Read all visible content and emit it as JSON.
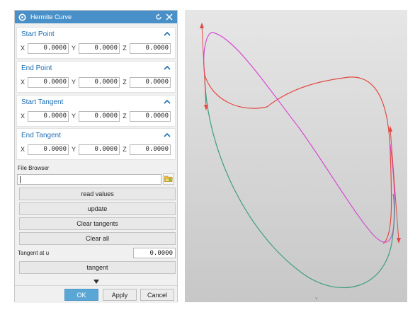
{
  "dialog": {
    "title": "Hermite Curve",
    "title_bar_color": "#4a90c8",
    "accent_text_color": "#1f6fb3",
    "sections": [
      {
        "title": "Start Point",
        "x": "0.0000",
        "y": "0.0000",
        "z": "0.0000"
      },
      {
        "title": "End Point",
        "x": "0.0000",
        "y": "0.0000",
        "z": "0.0000"
      },
      {
        "title": "Start Tangent",
        "x": "0.0000",
        "y": "0.0000",
        "z": "0.0000"
      },
      {
        "title": "End Tangent",
        "x": "0.0000",
        "y": "0.0000",
        "z": "0.0000"
      }
    ],
    "axis_labels": {
      "x": "X",
      "y": "Y",
      "z": "Z"
    },
    "file_browser": {
      "label": "File Browser",
      "value": ""
    },
    "buttons": {
      "read_values": "read values",
      "update": "update",
      "clear_tangents": "Clear tangents",
      "clear_all": "Clear all",
      "tangent": "tangent"
    },
    "tangent_at_u": {
      "label": "Tangent at u",
      "value": "0.0000"
    },
    "footer": {
      "ok": "OK",
      "apply": "Apply",
      "cancel": "Cancel",
      "ok_color": "#5aa7d6"
    }
  },
  "viewport": {
    "background_top": "#e6e6e6",
    "background_bottom": "#c7c7c7",
    "curves": [
      {
        "name": "red",
        "color": "#e14a45"
      },
      {
        "name": "magenta",
        "color": "#d64bd0"
      },
      {
        "name": "green",
        "color": "#3f9e82"
      }
    ],
    "axis_hint": "Y"
  }
}
